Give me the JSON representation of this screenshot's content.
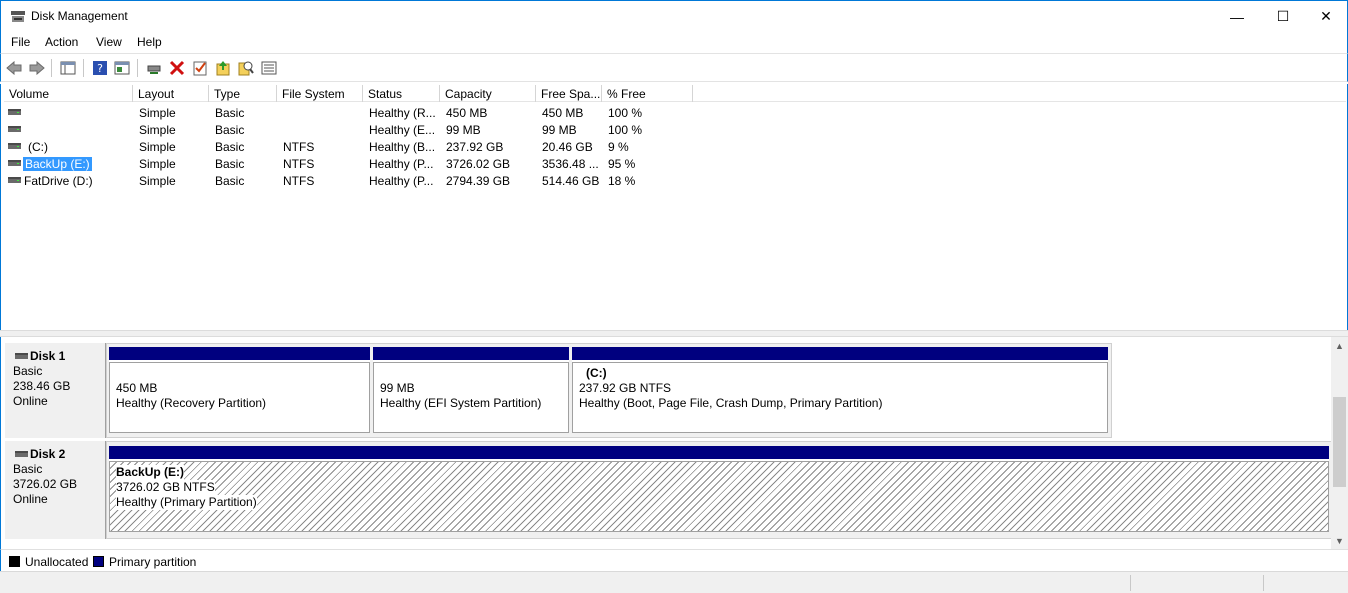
{
  "window": {
    "title": "Disk Management",
    "minimize_glyph": "—",
    "maximize_glyph": "☐",
    "close_glyph": "✕"
  },
  "menu": {
    "file": "File",
    "action": "Action",
    "view": "View",
    "help": "Help"
  },
  "toolbar": {
    "icons": [
      "back-arrow-icon",
      "forward-arrow-icon",
      "console-tree-icon",
      "help-icon",
      "properties-icon",
      "connect-disk-icon",
      "delete-icon",
      "check-icon",
      "export-icon",
      "search-icon",
      "list-icon"
    ]
  },
  "volume_list": {
    "columns": [
      "Volume",
      "Layout",
      "Type",
      "File System",
      "Status",
      "Capacity",
      "Free Spa...",
      "% Free"
    ],
    "rows": [
      {
        "volume": "",
        "layout": "Simple",
        "type": "Basic",
        "fs": "",
        "status": "Healthy (R...",
        "capacity": "450 MB",
        "free": "450 MB",
        "pct": "100 %"
      },
      {
        "volume": "",
        "layout": "Simple",
        "type": "Basic",
        "fs": "",
        "status": "Healthy (E...",
        "capacity": "99 MB",
        "free": "99 MB",
        "pct": "100 %"
      },
      {
        "volume": "(C:)",
        "layout": "Simple",
        "type": "Basic",
        "fs": "NTFS",
        "status": "Healthy (B...",
        "capacity": "237.92 GB",
        "free": "20.46 GB",
        "pct": "9 %"
      },
      {
        "volume": "BackUp (E:)",
        "layout": "Simple",
        "type": "Basic",
        "fs": "NTFS",
        "status": "Healthy (P...",
        "capacity": "3726.02 GB",
        "free": "3536.48 ...",
        "pct": "95 %"
      },
      {
        "volume": "FatDrive (D:)",
        "layout": "Simple",
        "type": "Basic",
        "fs": "NTFS",
        "status": "Healthy (P...",
        "capacity": "2794.39 GB",
        "free": "514.46 GB",
        "pct": "18 %"
      }
    ]
  },
  "disks": [
    {
      "name": "Disk 1",
      "type": "Basic",
      "size": "238.46 GB",
      "state": "Online",
      "partitions": [
        {
          "name": "",
          "size": "450 MB",
          "status": "Healthy (Recovery Partition)"
        },
        {
          "name": "",
          "size": "99 MB",
          "status": "Healthy (EFI System Partition)"
        },
        {
          "name": "(C:)",
          "size": "237.92 GB NTFS",
          "status": "Healthy (Boot, Page File, Crash Dump, Primary Partition)"
        }
      ]
    },
    {
      "name": "Disk 2",
      "type": "Basic",
      "size": "3726.02 GB",
      "state": "Online",
      "partitions": [
        {
          "name": "BackUp  (E:)",
          "size": "3726.02 GB NTFS",
          "status": "Healthy (Primary Partition)"
        }
      ]
    }
  ],
  "legend": {
    "unallocated": "Unallocated",
    "primary": "Primary partition",
    "unallocated_color": "#000000",
    "primary_color": "#00007f"
  },
  "scroll": {
    "up": "▲",
    "down": "▼"
  }
}
